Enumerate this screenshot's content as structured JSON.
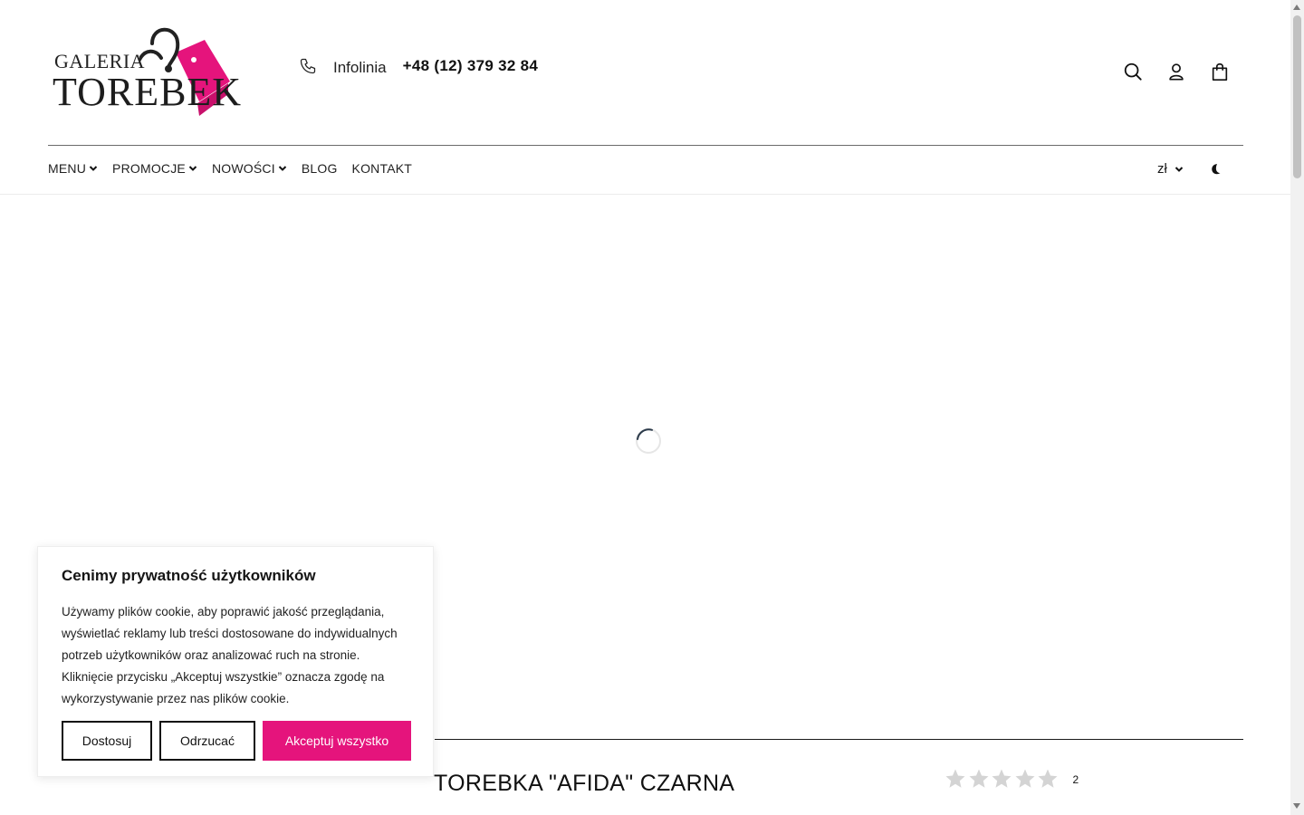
{
  "brand": {
    "line1": "GALERIA",
    "line2": "TOREBEK",
    "accent_color": "#e5147c"
  },
  "header": {
    "infolinia_label": "Infolinia",
    "phone_number": "+48 (12) 379 32 84",
    "icons": [
      "phone-icon",
      "search-icon",
      "user-icon",
      "cart-icon"
    ]
  },
  "nav": {
    "items": [
      {
        "label": "MENU",
        "has_dropdown": true
      },
      {
        "label": "PROMOCJE",
        "has_dropdown": true
      },
      {
        "label": "NOWOŚCI",
        "has_dropdown": true
      },
      {
        "label": "BLOG",
        "has_dropdown": false
      },
      {
        "label": "KONTAKT",
        "has_dropdown": false
      }
    ],
    "currency": "zł",
    "theme_icon": "moon-icon"
  },
  "product": {
    "title": "TOREBKA \"AFIDA\" CZARNA",
    "rating": 0,
    "rating_max": 5,
    "review_count": "2"
  },
  "cookie_banner": {
    "title": "Cenimy prywatność użytkowników",
    "text": "Używamy plików cookie, aby poprawić jakość przeglądania, wyświetlać reklamy lub treści dostosowane do indywidualnych potrzeb użytkowników oraz analizować ruch na stronie. Kliknięcie przycisku „Akceptuj wszystkie” oznacza zgodę na wykorzystywanie przez nas plików cookie.",
    "buttons": {
      "customize": "Dostosuj",
      "reject": "Odrzucać",
      "accept": "Akceptuj wszystko"
    }
  }
}
